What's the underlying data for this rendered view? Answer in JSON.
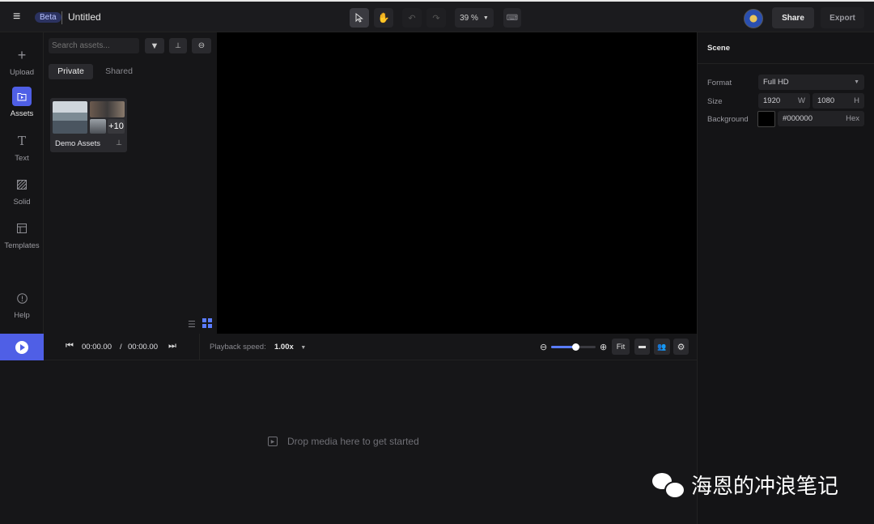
{
  "header": {
    "badge": "Beta",
    "title": "Untitled",
    "zoom": "39 %",
    "share_label": "Share",
    "export_label": "Export",
    "tools": [
      "pointer-tool",
      "hand-tool",
      "undo",
      "redo",
      "keyboard-shortcuts"
    ]
  },
  "rail": {
    "items": [
      {
        "label": "Upload",
        "icon": "plus-icon"
      },
      {
        "label": "Assets",
        "icon": "folder-play-icon",
        "active": true
      },
      {
        "label": "Text",
        "icon": "text-icon"
      },
      {
        "label": "Solid",
        "icon": "solid-pattern-icon"
      },
      {
        "label": "Templates",
        "icon": "template-layout-icon"
      },
      {
        "label": "Help",
        "icon": "help-icon"
      }
    ]
  },
  "assets": {
    "search_placeholder": "Search assets...",
    "tabs": [
      {
        "label": "Private",
        "active": true
      },
      {
        "label": "Shared",
        "active": false
      }
    ],
    "folders": [
      {
        "name": "Demo Assets",
        "more_count": "+10",
        "pinned": true
      }
    ]
  },
  "scene": {
    "title": "Scene",
    "format_label": "Format",
    "format_value": "Full HD",
    "size_label": "Size",
    "width": "1920",
    "width_suffix": "W",
    "height": "1080",
    "height_suffix": "H",
    "background_label": "Background",
    "background_hex": "#000000",
    "background_suffix": "Hex"
  },
  "transport": {
    "current_time": "00:00.00",
    "separator": "/",
    "total_time": "00:00.00",
    "speed_label": "Playback speed:",
    "speed_value": "1.00x",
    "zoom_level": 0.55,
    "fit_label": "Fit"
  },
  "timeline": {
    "drop_text": "Drop media here to get started"
  },
  "watermark": {
    "text": "海恩的冲浪笔记"
  },
  "colors": {
    "accent": "#4f5fe6",
    "canvas_bg": "#000000",
    "panel_bg": "#161618"
  }
}
